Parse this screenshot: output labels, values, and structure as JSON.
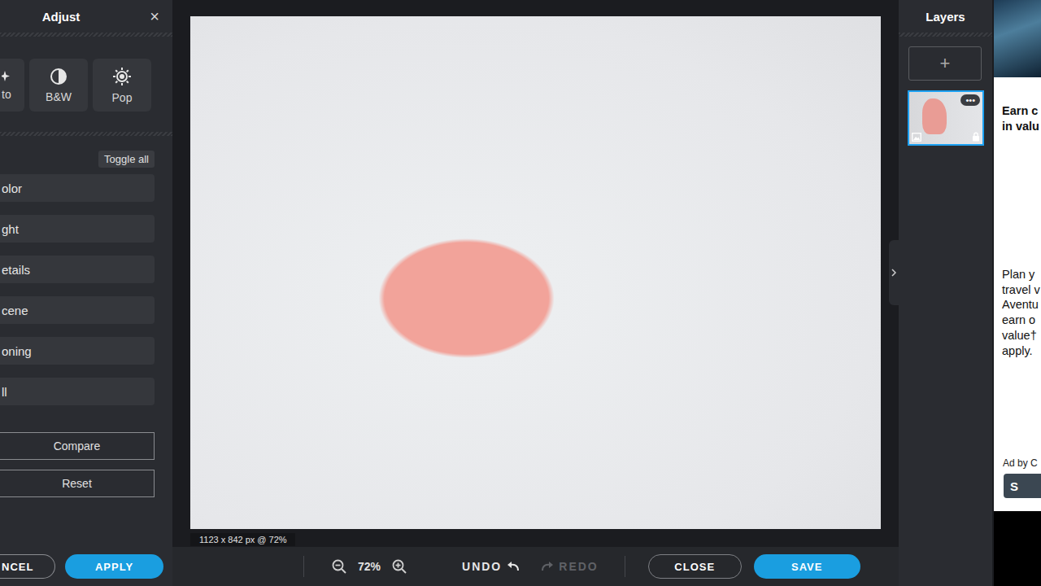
{
  "left_panel": {
    "title": "Adjust",
    "close": "×",
    "presets": [
      {
        "label": "to"
      },
      {
        "label": "B&W"
      },
      {
        "label": "Pop"
      }
    ],
    "toggle_all": "Toggle all",
    "sections": [
      "olor",
      "ght",
      "etails",
      "cene",
      "oning",
      "ll"
    ],
    "compare": "Compare",
    "reset": "Reset",
    "cancel": "NCEL",
    "apply": "APPLY"
  },
  "canvas": {
    "info": "1123 x 842 px @ 72%"
  },
  "toolbar": {
    "zoom": "72%",
    "undo": {
      "label": "UNDO",
      "disabled": false
    },
    "redo": {
      "label": "REDO",
      "disabled": true
    },
    "close": "CLOSE",
    "save": "SAVE"
  },
  "layers": {
    "title": "Layers",
    "add": "+",
    "items": [
      {
        "menu": "•••",
        "locked": true,
        "selected": true
      }
    ]
  },
  "ad": {
    "headline": [
      "Earn c",
      "in valu"
    ],
    "body": [
      "Plan y",
      "travel v",
      "Aventu",
      "earn o",
      "value†",
      "apply."
    ],
    "attribution": "Ad by C",
    "button": "S"
  }
}
